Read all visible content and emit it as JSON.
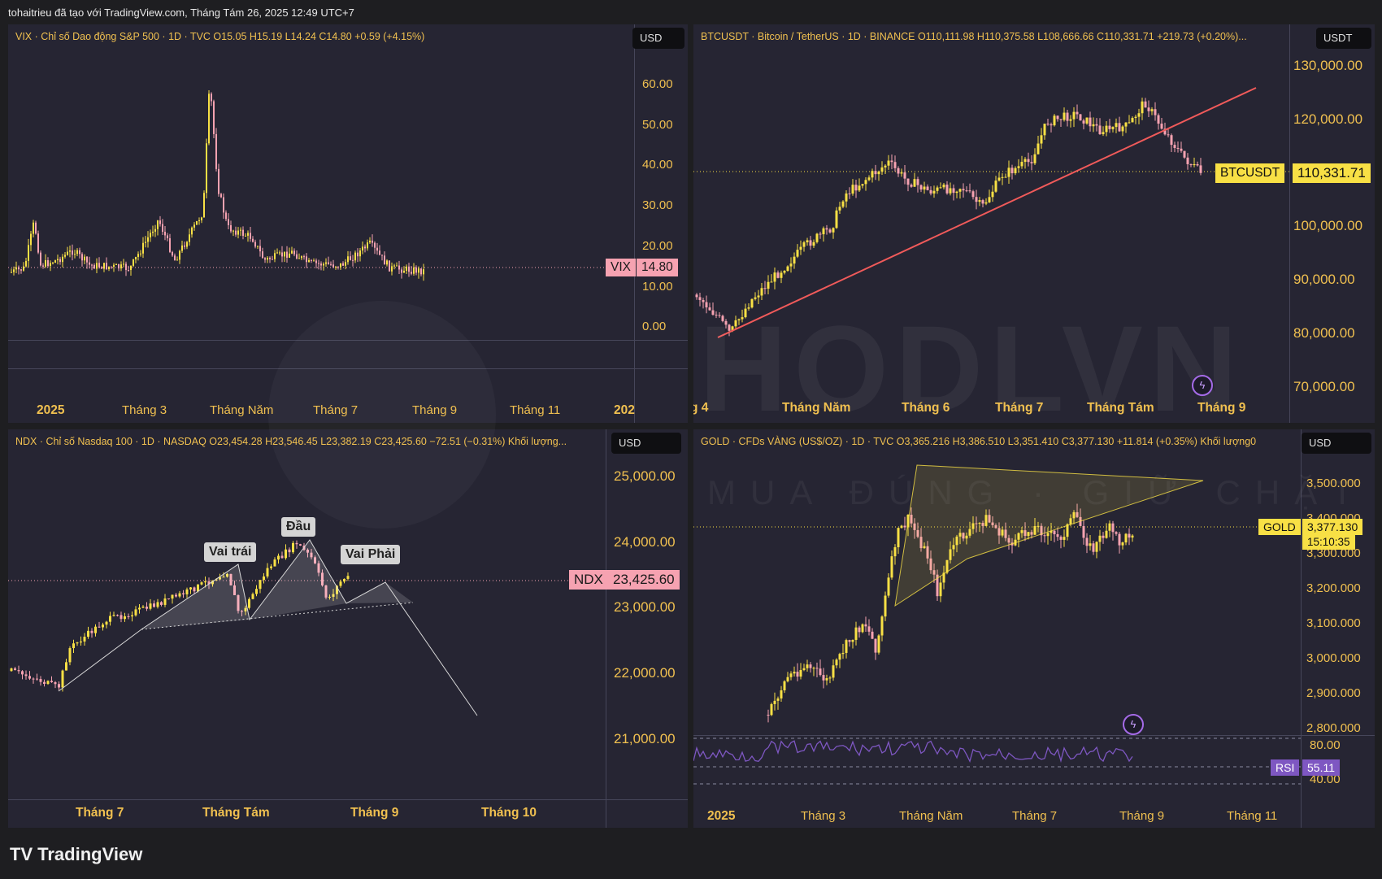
{
  "window": {
    "title": "tohaitrieu đã tạo với TradingView.com, Tháng Tám 26, 2025 12:49 UTC+7"
  },
  "colors": {
    "background": "#262533",
    "up": "#f8e045",
    "down": "#f6a2b1",
    "axis_text": "#f0c050",
    "trendline": "#f05a5a",
    "rsi": "#7e57c2"
  },
  "vix": {
    "legend": "VIX · Chỉ số Dao động S&P 500 · 1D · TVC  O15.05  H15.19  L14.24  C14.80  +0.59 (+4.15%)",
    "currency": "USD",
    "price_tag_label": "VIX",
    "price_tag_value": "14.80",
    "y_ticks": [
      "60.00",
      "50.00",
      "40.00",
      "30.00",
      "20.00",
      "10.00",
      "0.00"
    ],
    "x_ticks": [
      "2025",
      "Tháng 3",
      "Tháng Năm",
      "Tháng 7",
      "Tháng 9",
      "Tháng 11",
      "202"
    ]
  },
  "btc": {
    "legend": "BTCUSDT · Bitcoin / TetherUS · 1D · BINANCE  O110,111.98  H110,375.58  L108,666.66  C110,331.71  +219.73 (+0.20%)...",
    "currency": "USDT",
    "price_tag_label": "BTCUSDT",
    "price_tag_value": "110,331.71",
    "y_ticks": [
      "130,000.00",
      "120,000.00",
      "100,000.00",
      "90,000.00",
      "80,000.00",
      "70,000.00"
    ],
    "x_ticks": [
      "g 4",
      "Tháng Năm",
      "Tháng 6",
      "Tháng 7",
      "Tháng Tám",
      "Tháng 9"
    ]
  },
  "ndx": {
    "legend": "NDX · Chỉ số Nasdaq 100 · 1D · NASDAQ  O23,454.28  H23,546.45  L23,382.19  C23,425.60  −72.51 (−0.31%)  Khối lượng...",
    "currency": "USD",
    "price_tag_label": "NDX",
    "price_tag_value": "23,425.60",
    "y_ticks": [
      "25,000.00",
      "24,000.00",
      "23,000.00",
      "22,000.00",
      "21,000.00"
    ],
    "x_ticks": [
      "Tháng 7",
      "Tháng Tám",
      "Tháng 9",
      "Tháng 10"
    ],
    "callouts": {
      "left_shoulder": "Vai trái",
      "head": "Đầu",
      "right_shoulder": "Vai Phải"
    }
  },
  "gold": {
    "legend": "GOLD · CFDs VÀNG (US$/OZ) · 1D · TVC  O3,365.216  H3,386.510  L3,351.410  C3,377.130  +11.814 (+0.35%)  Khối lượng0",
    "currency": "USD",
    "price_tag_label": "GOLD",
    "price_tag_value": "3,377.130",
    "countdown": "15:10:35",
    "y_ticks": [
      "3,500.000",
      "3,400.000",
      "3,300.000",
      "3,200.000",
      "3,100.000",
      "3,000.000",
      "2,900.000",
      "2,800.000"
    ],
    "x_ticks": [
      "2025",
      "Tháng 3",
      "Tháng Năm",
      "Tháng 7",
      "Tháng 9",
      "Tháng 11"
    ],
    "rsi_label": "RSI",
    "rsi_value": "55.11",
    "rsi_ticks": [
      "80.00",
      "40.00"
    ]
  },
  "branding": {
    "logo_text": "TradingView",
    "watermark": "HODLVN",
    "watermark_slogan": "MUA ĐÚNG · GIỮ CHẶT"
  }
}
